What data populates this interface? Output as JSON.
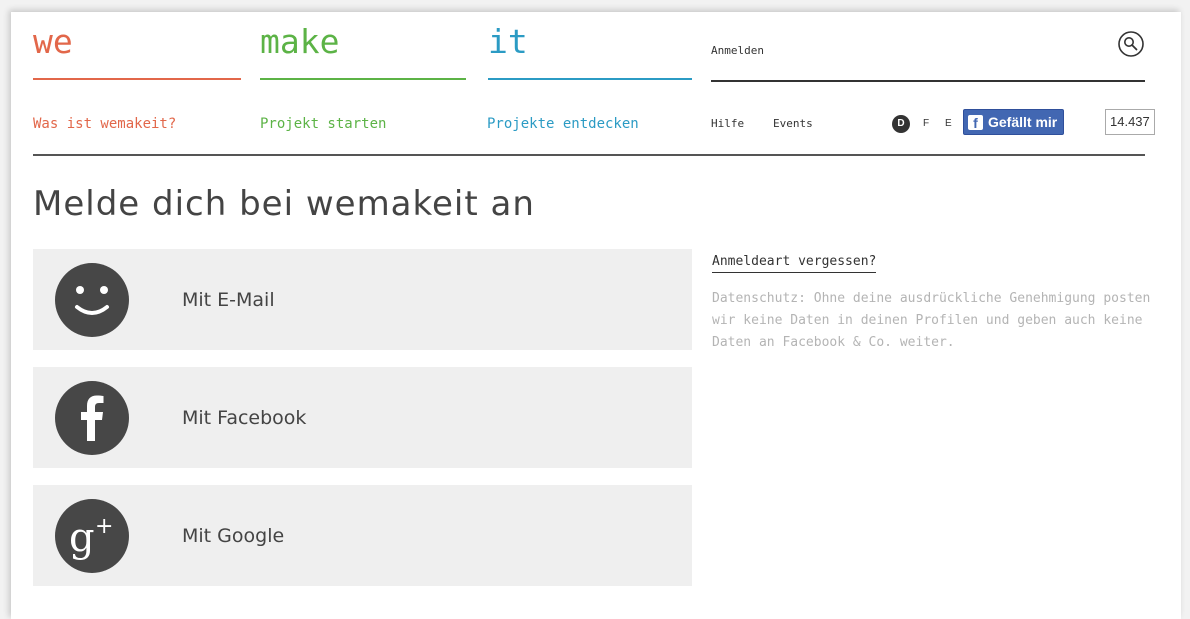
{
  "logo": {
    "we": "we",
    "make": "make",
    "it": "it"
  },
  "header": {
    "login_link": "Anmelden"
  },
  "nav": {
    "was_ist": "Was ist wemakeit?",
    "projekt_starten": "Projekt starten",
    "projekte_entdecken": "Projekte entdecken",
    "hilfe": "Hilfe",
    "events": "Events"
  },
  "languages": {
    "de": "D",
    "fr": "F",
    "en": "E"
  },
  "facebook_like": {
    "label": "Gefällt mir",
    "count": "14.437"
  },
  "title": "Melde dich bei wemakeit an",
  "options": [
    {
      "label": "Mit E-Mail",
      "icon": "smiley-icon"
    },
    {
      "label": "Mit Facebook",
      "icon": "facebook-icon"
    },
    {
      "label": "Mit Google",
      "icon": "google-plus-icon"
    }
  ],
  "sidebar": {
    "forgot_link": "Anmeldeart vergessen?",
    "privacy_text": "Datenschutz: Ohne deine ausdrückliche Genehmigung posten wir keine Daten in deinen Profilen und geben auch keine Daten an Facebook & Co. weiter."
  },
  "colors": {
    "we": "#e2674a",
    "make": "#5cb346",
    "it": "#2b9bc4",
    "facebook": "#4267b2"
  }
}
